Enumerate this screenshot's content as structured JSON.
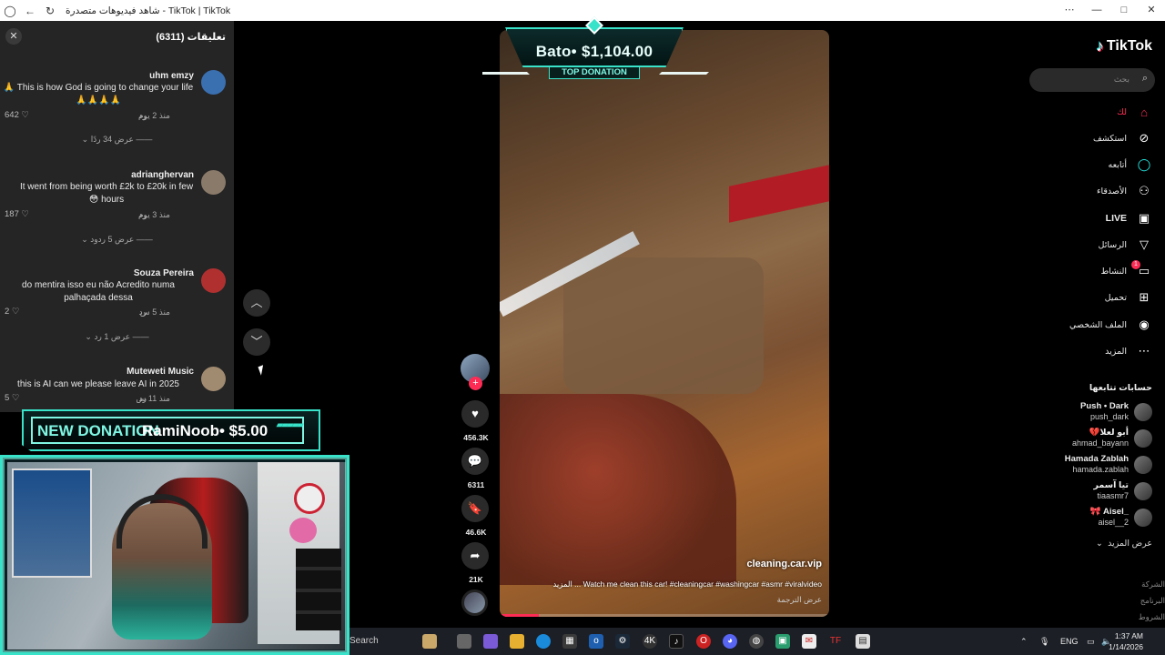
{
  "browser": {
    "title": "شاهد فيديوهات متصدرة - TikTok | TikTok",
    "controls": [
      "—",
      "□",
      "⧉",
      "✕"
    ]
  },
  "comments_panel": {
    "title": "تعليقات (6311)",
    "comments": [
      {
        "user": "uhm emzy",
        "text": "🙏 This is how God is going to change your life 🙏🙏🙏🙏",
        "time": "منذ 2 يوم",
        "reply": "رد",
        "likes": "642",
        "more": "عرض 34 ردًا",
        "avatar_color": "#3a6fb0"
      },
      {
        "user": "adrianghervan",
        "text": "It went from being worth £2k to £20k in few 😳 hours",
        "time": "منذ 3 يوم",
        "reply": "رد",
        "likes": "187",
        "more": "عرض 5 ردود",
        "avatar_color": "#8a7a6a"
      },
      {
        "user": "Souza Pereira",
        "text": "do mentira isso eu não Acredito numa palhaçada dessa",
        "time": "منذ 5 س",
        "reply": "رد",
        "likes": "2",
        "more": "عرض 1 رد",
        "avatar_color": "#b03030"
      },
      {
        "user": "Muteweti Music",
        "text": "this is AI can we please leave AI in 2025",
        "time": "منذ 11 س",
        "reply": "رد",
        "likes": "5",
        "more": "",
        "avatar_color": "#a08a70"
      }
    ]
  },
  "video": {
    "author": "cleaning.car.vip",
    "description": "Watch me clean this car! #cleaningcar #washingcar #asmr #viralvideo ... المزيد",
    "translate": "عرض الترجمة",
    "progress_percent": 12
  },
  "top_donation": {
    "amount": "Bato• $1,104.00",
    "label": "TOP DONATION"
  },
  "new_donation": {
    "label": "NEW DONATION",
    "who": "RamiNoob• $5.00"
  },
  "actions": {
    "likes": "456.3K",
    "comments": "6311",
    "saves": "46.6K",
    "shares": "21K"
  },
  "sidebar": {
    "logo": "TikTok",
    "search_placeholder": "بحث",
    "nav": [
      {
        "label": "لك",
        "icon": "home-icon",
        "active": true
      },
      {
        "label": "استكشف",
        "icon": "compass-icon"
      },
      {
        "label": "أتابعه",
        "icon": "following-icon"
      },
      {
        "label": "الأصدقاء",
        "icon": "friends-icon"
      },
      {
        "label": "LIVE",
        "icon": "live-icon"
      },
      {
        "label": "الرسائل",
        "icon": "messages-icon"
      },
      {
        "label": "النشاط",
        "icon": "activity-icon",
        "badge": "1"
      },
      {
        "label": "تحميل",
        "icon": "upload-icon"
      },
      {
        "label": "الملف الشخصي",
        "icon": "profile-icon"
      },
      {
        "label": "المزيد",
        "icon": "more-icon"
      }
    ],
    "following_title": "حسابات تتابعها",
    "following": [
      {
        "name": "Push • Dark",
        "handle": "push_dark"
      },
      {
        "name": "💔أبو لعلا",
        "handle": "ahmad_bayann"
      },
      {
        "name": "Hamada Zablah",
        "handle": "hamada.zablah"
      },
      {
        "name": "تيا آسمر",
        "handle": "tiaasmr7"
      },
      {
        "name": "🎀 Aisel_",
        "handle": "aisel__2"
      }
    ],
    "show_more": "عرض المزيد",
    "footer": [
      "الشركة",
      "البرنامج",
      "الشروط والسياسات"
    ]
  },
  "taskbar": {
    "search": "Search",
    "lang": "ENG",
    "time": "1:37 AM",
    "date": "1/14/2026"
  }
}
